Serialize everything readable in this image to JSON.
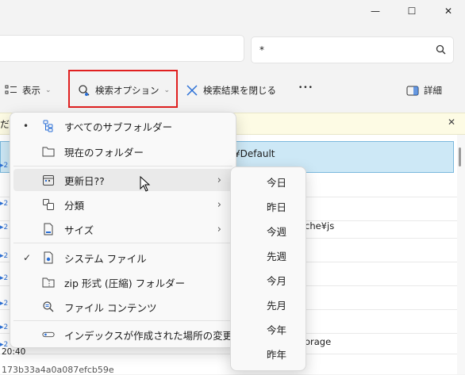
{
  "window": {
    "minimize_glyph": "—",
    "maximize_glyph": "☐",
    "close_glyph": "✕"
  },
  "search": {
    "value": "*",
    "icon": "search-icon"
  },
  "toolbar": {
    "view_label": "表示",
    "search_options_label": "検索オプション",
    "close_results_label": "検索結果を閉じる",
    "more_label": "•••",
    "details_label": "詳細"
  },
  "infobar": {
    "partial_text": "だ",
    "close_glyph": "✕"
  },
  "list": {
    "selected_row_text": "¥Default",
    "row_texts": [
      {
        "text": "che¥js"
      },
      {
        "text": "orage"
      },
      {
        "text": "20:40"
      },
      {
        "text": "173b33a4a0a087efcb59e"
      }
    ],
    "left_fragments": [
      "▸2",
      "▸2",
      "▸2",
      "▸2",
      "▸2",
      "▸2",
      "▸2",
      "▸2"
    ]
  },
  "menu": {
    "items": [
      {
        "label": "すべてのサブフォルダー",
        "icon": "subfolders-icon",
        "mark": "•"
      },
      {
        "label": "現在のフォルダー",
        "icon": "folder-icon",
        "mark": ""
      },
      {
        "label": "更新日??",
        "icon": "calendar-icon",
        "mark": "",
        "arrow": "›"
      },
      {
        "label": "分類",
        "icon": "category-icon",
        "mark": "",
        "arrow": "›"
      },
      {
        "label": "サイズ",
        "icon": "size-icon",
        "mark": "",
        "arrow": "›"
      },
      {
        "label": "システム ファイル",
        "icon": "system-file-icon",
        "mark": "✓"
      },
      {
        "label": "zip 形式 (圧縮) フォルダー",
        "icon": "zip-folder-icon",
        "mark": ""
      },
      {
        "label": "ファイル コンテンツ",
        "icon": "file-content-icon",
        "mark": ""
      },
      {
        "label": "インデックスが作成された場所の変更",
        "icon": "index-location-icon",
        "mark": ""
      }
    ]
  },
  "submenu": {
    "items": [
      "今日",
      "昨日",
      "今週",
      "先週",
      "今月",
      "先月",
      "今年",
      "昨年"
    ]
  }
}
